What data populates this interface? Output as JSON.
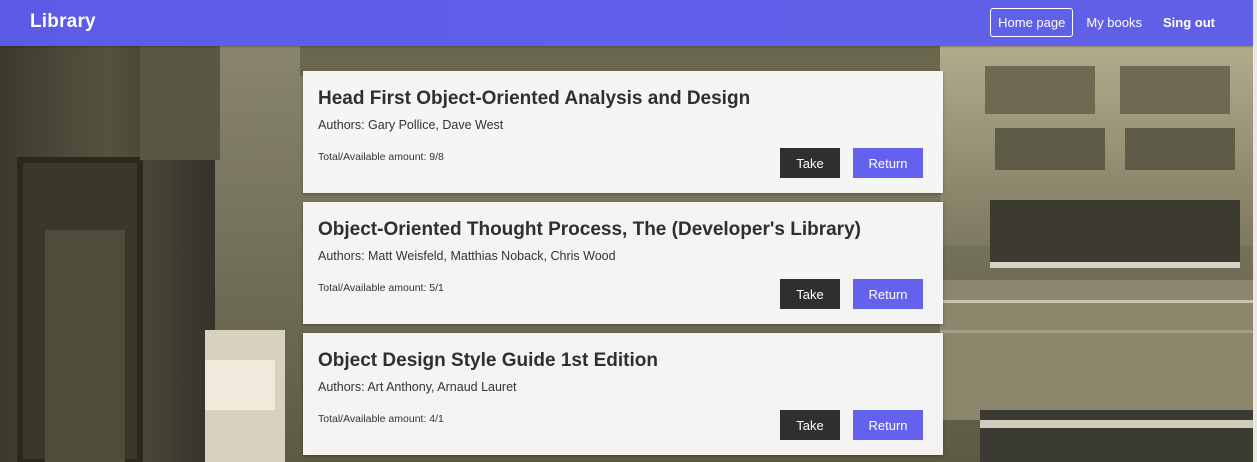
{
  "app": {
    "brand": "Library"
  },
  "nav": {
    "items": [
      {
        "label": "Home page",
        "active": true
      },
      {
        "label": "My books",
        "active": false
      },
      {
        "label": "Sing out",
        "active": false
      }
    ]
  },
  "books": [
    {
      "title": "Head First Object-Oriented Analysis and Design",
      "authors": "Authors: Gary Pollice, Dave West",
      "amount": "Total/Available amount: 9/8",
      "take_label": "Take",
      "return_label": "Return"
    },
    {
      "title": "Object-Oriented Thought Process, The (Developer's Library)",
      "authors": "Authors: Matt Weisfeld, Matthias Noback, Chris Wood",
      "amount": "Total/Available amount: 5/1",
      "take_label": "Take",
      "return_label": "Return"
    },
    {
      "title": "Object Design Style Guide 1st Edition",
      "authors": "Authors: Art Anthony, Arnaud Lauret",
      "amount": "Total/Available amount: 4/1",
      "take_label": "Take",
      "return_label": "Return"
    }
  ],
  "colors": {
    "navbar": "#5f5fe8",
    "take_button": "#2f2f2f",
    "return_button": "#6461ee",
    "card": "#fafafa"
  }
}
